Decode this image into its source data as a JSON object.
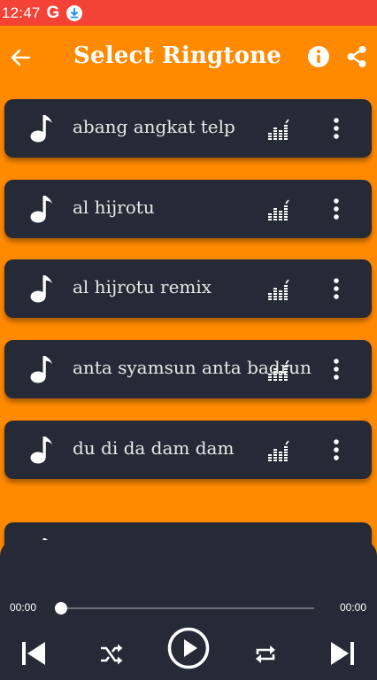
{
  "status_bar": {
    "time": "12:47",
    "google_badge": "G",
    "download_icon": "download-icon"
  },
  "app_bar": {
    "title": "Select Ringtone",
    "back_icon": "arrow-back-icon",
    "info_icon": "info-icon",
    "share_icon": "share-icon"
  },
  "ringtones": [
    {
      "name": "abang angkat telp"
    },
    {
      "name": "al hijrotu"
    },
    {
      "name": "al hijrotu remix"
    },
    {
      "name": "anta syamsun anta badrun"
    },
    {
      "name": "du di da dam dam"
    },
    {
      "name": ""
    }
  ],
  "player": {
    "current_time": "00:00",
    "total_time": "00:00",
    "progress": 0
  },
  "colors": {
    "background": "#ff8a00",
    "status_bar": "#f44336",
    "card": "#262a37",
    "text": "#ffffff"
  }
}
